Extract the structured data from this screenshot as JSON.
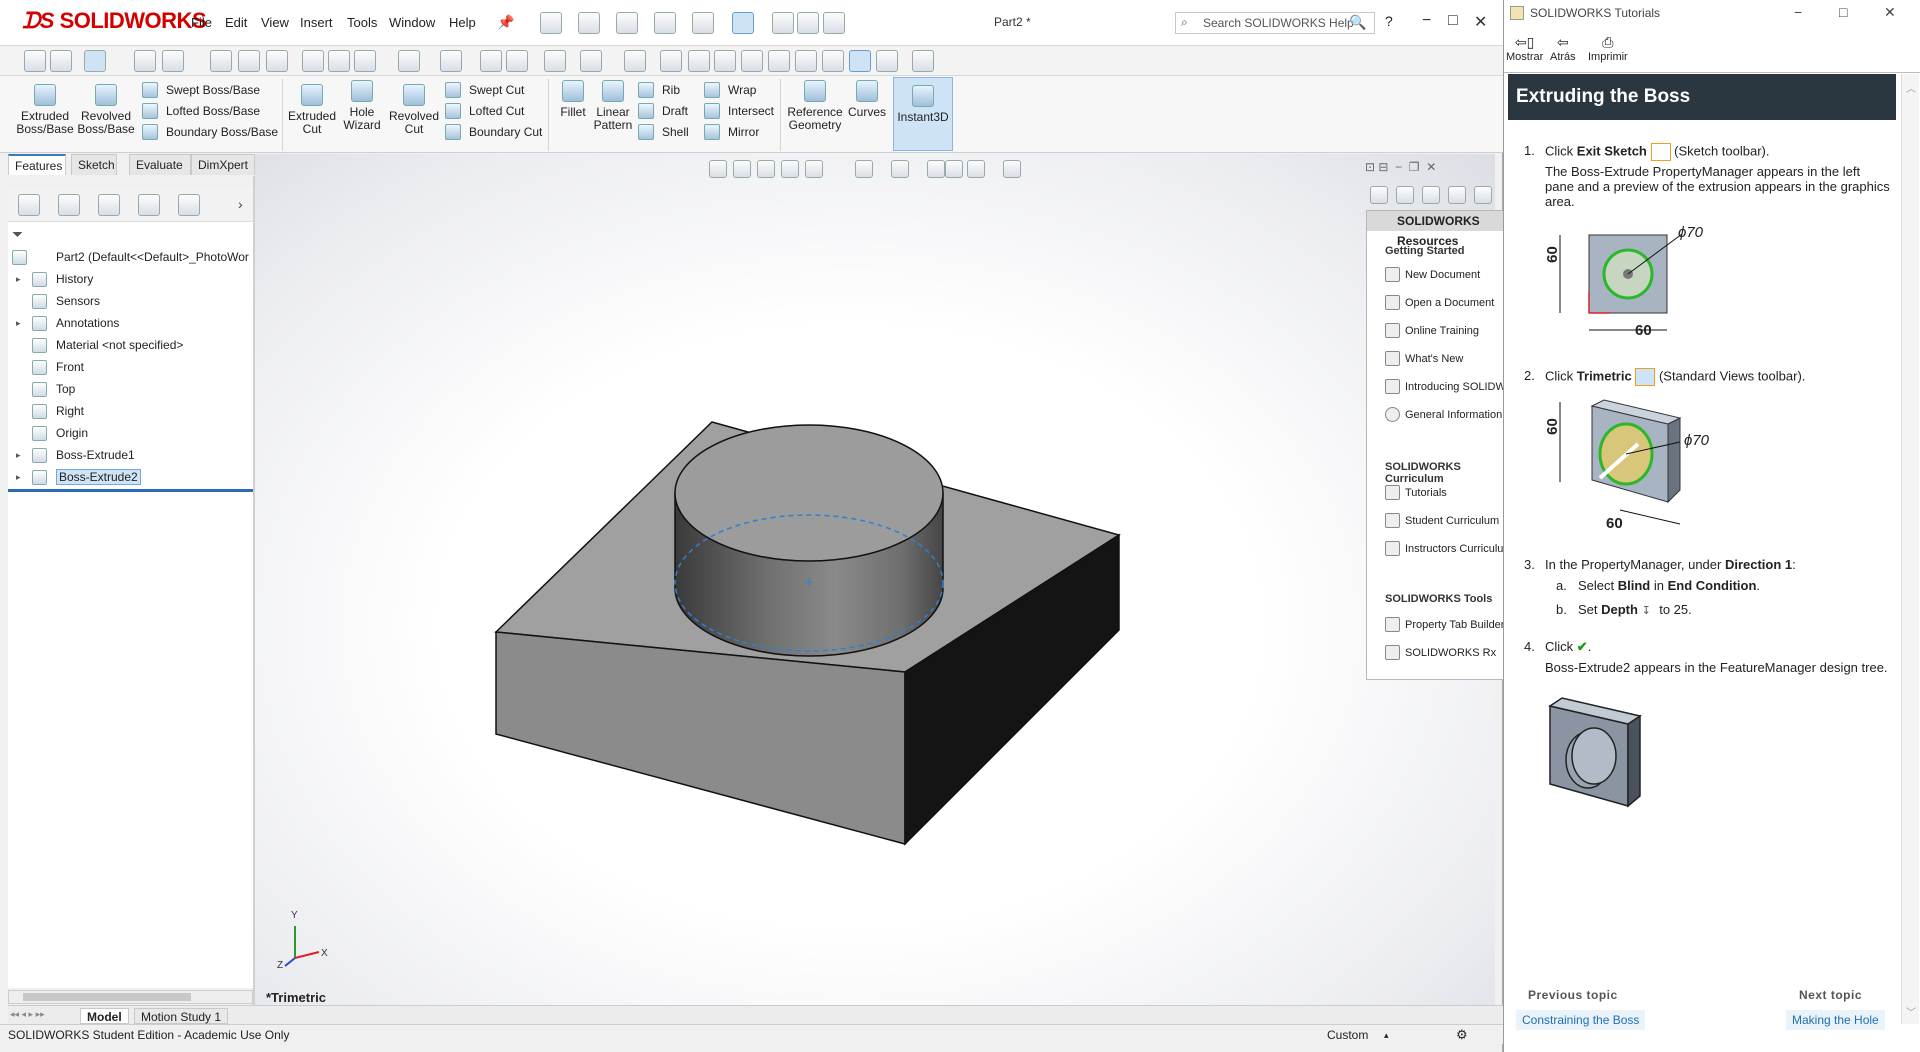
{
  "app": {
    "logo": "SOLIDWORKS",
    "doc_title": "Part2 *",
    "menus": [
      "File",
      "Edit",
      "View",
      "Insert",
      "Tools",
      "Window",
      "Help"
    ],
    "search_placeholder": "Search SOLIDWORKS Help",
    "help_glyph": "?"
  },
  "ribbon": {
    "big": [
      {
        "icon": "extruded-boss-icon",
        "label": "Extruded Boss/Base"
      },
      {
        "icon": "revolved-boss-icon",
        "label": "Revolved Boss/Base"
      }
    ],
    "small_col1": [
      "Swept Boss/Base",
      "Lofted Boss/Base",
      "Boundary Boss/Base"
    ],
    "big2": [
      {
        "icon": "extruded-cut-icon",
        "label": "Extruded Cut"
      },
      {
        "icon": "hole-wizard-icon",
        "label": "Hole Wizard"
      },
      {
        "icon": "revolved-cut-icon",
        "label": "Revolved Cut"
      }
    ],
    "small_col2": [
      "Swept Cut",
      "Lofted Cut",
      "Boundary Cut"
    ],
    "big3": [
      {
        "icon": "fillet-icon",
        "label": "Fillet"
      },
      {
        "icon": "linear-pattern-icon",
        "label": "Linear Pattern"
      }
    ],
    "small_col3": [
      "Rib",
      "Draft",
      "Shell"
    ],
    "small_col4": [
      "Wrap",
      "Intersect",
      "Mirror"
    ],
    "big4": [
      {
        "icon": "reference-geometry-icon",
        "label": "Reference Geometry"
      },
      {
        "icon": "curves-icon",
        "label": "Curves"
      },
      {
        "icon": "instant3d-icon",
        "label": "Instant3D"
      }
    ]
  },
  "command_tabs": [
    "Features",
    "Sketch",
    "Evaluate",
    "DimXpert"
  ],
  "feature_tree": {
    "root": "Part2  (Default<<Default>_PhotoWor",
    "items": [
      {
        "label": "History",
        "expandable": true
      },
      {
        "label": "Sensors",
        "expandable": false
      },
      {
        "label": "Annotations",
        "expandable": true
      },
      {
        "label": "Material <not specified>",
        "expandable": false
      },
      {
        "label": "Front",
        "expandable": false
      },
      {
        "label": "Top",
        "expandable": false
      },
      {
        "label": "Right",
        "expandable": false
      },
      {
        "label": "Origin",
        "expandable": false
      },
      {
        "label": "Boss-Extrude1",
        "expandable": true
      },
      {
        "label": "Boss-Extrude2",
        "expandable": true,
        "selected": true
      }
    ]
  },
  "viewport": {
    "view_label": "*Trimetric",
    "axes": {
      "x": "X",
      "y": "Y",
      "z": "Z"
    }
  },
  "task_pane": {
    "header": "SOLIDWORKS Resources",
    "sections": [
      {
        "title": "Getting Started",
        "items": [
          "New Document",
          "Open a Document",
          "Online Training",
          "What's New",
          "Introducing SOLIDWORKS",
          "General Information"
        ]
      },
      {
        "title": "SOLIDWORKS Curriculum",
        "items": [
          "Tutorials",
          "Student Curriculum",
          "Instructors Curriculum"
        ]
      },
      {
        "title": "SOLIDWORKS Tools",
        "items": [
          "Property Tab Builder",
          "SOLIDWORKS Rx"
        ]
      }
    ]
  },
  "bottom_tabs": [
    "Model",
    "Motion Study 1"
  ],
  "status": {
    "left": "SOLIDWORKS Student Edition - Academic Use Only",
    "units": "Custom"
  },
  "tutorial": {
    "window_title": "SOLIDWORKS Tutorials",
    "toolbar": [
      "Mostrar",
      "Atrás",
      "Imprimir"
    ],
    "heading": "Extruding the Boss",
    "steps": {
      "s1_num": "1.",
      "s1_a": "Click ",
      "s1_b": "Exit Sketch",
      "s1_c": " (Sketch toolbar).",
      "s1_desc": "The Boss-Extrude PropertyManager appears in the left pane and a preview of the extrusion appears in the graphics area.",
      "s2_num": "2.",
      "s2_a": "Click ",
      "s2_b": "Trimetric",
      "s2_c": " (Standard Views toolbar).",
      "s3_num": "3.",
      "s3_a": "In the PropertyManager, under ",
      "s3_b": "Direction 1",
      "s3_c": ":",
      "s3a_num": "a.",
      "s3a_a": "Select ",
      "s3a_b": "Blind",
      "s3a_c": " in ",
      "s3a_d": "End Condition",
      "s3a_e": ".",
      "s3b_num": "b.",
      "s3b_a": "Set ",
      "s3b_b": "Depth",
      "s3b_c": " to 25.",
      "s4_num": "4.",
      "s4_a": "Click ",
      "s4_c": ".",
      "s4_desc": "Boss-Extrude2 appears in the FeatureManager design tree."
    },
    "fig1": {
      "dim_h": "60",
      "dim_w": "60",
      "dim_d": "ϕ70"
    },
    "fig2": {
      "dim_h": "60",
      "dim_w": "60",
      "dim_d": "ϕ70"
    },
    "prev_label": "Previous topic",
    "prev_link": "Constraining the Boss",
    "next_label": "Next topic",
    "next_link": "Making the Hole"
  }
}
